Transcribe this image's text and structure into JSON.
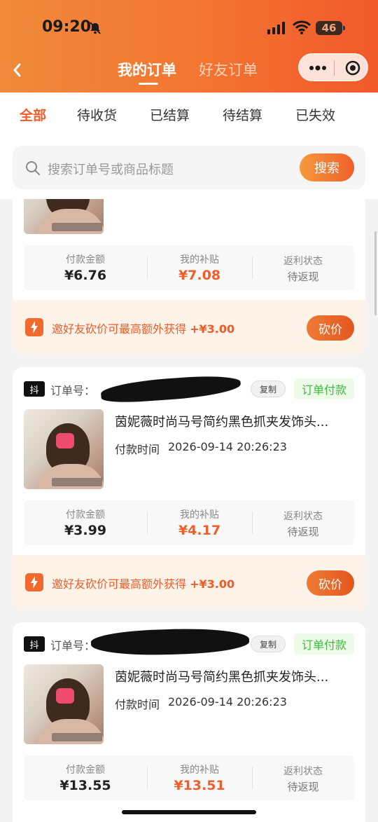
{
  "status_bar": {
    "time": "09:20",
    "battery": "46"
  },
  "header": {
    "tabs": [
      {
        "label": "我的订单",
        "active": true
      },
      {
        "label": "好友订单",
        "active": false
      }
    ]
  },
  "filters": {
    "tabs": [
      {
        "label": "全部",
        "active": true
      },
      {
        "label": "待收货",
        "active": false
      },
      {
        "label": "已结算",
        "active": false
      },
      {
        "label": "待结算",
        "active": false
      },
      {
        "label": "已失效",
        "active": false
      }
    ]
  },
  "search": {
    "placeholder": "搜索订单号或商品标题",
    "button_label": "搜索"
  },
  "labels": {
    "order_no": "订单号：",
    "copy": "复制",
    "pay_time": "付款时间",
    "pay_amount": "付款金额",
    "subsidy": "我的补贴",
    "rebate_status": "返利状态",
    "promo_text": "邀好友砍价可最高额外获得",
    "promo_amount": "+¥3.00",
    "bargain": "砍价",
    "platform": "抖"
  },
  "orders": [
    {
      "status": "",
      "title": "",
      "pay_time": "",
      "pay_amount": "¥6.76",
      "subsidy": "¥7.08",
      "rebate_status": "待返现"
    },
    {
      "status": "订单付款",
      "title": "茵妮薇时尚马号简约黑色抓夹发饰头...",
      "pay_time": "2026-09-14 20:26:23",
      "pay_amount": "¥3.99",
      "subsidy": "¥4.17",
      "rebate_status": "待返现"
    },
    {
      "status": "订单付款",
      "title": "茵妮薇时尚马号简约黑色抓夹发饰头...",
      "pay_time": "2026-09-14 20:26:23",
      "pay_amount": "¥13.55",
      "subsidy": "¥13.51",
      "rebate_status": "待返现"
    }
  ],
  "colors": {
    "accent": "#ef5c2a",
    "paid_status": "#3bbd3e",
    "promo_bg": "#fdf3e8"
  }
}
